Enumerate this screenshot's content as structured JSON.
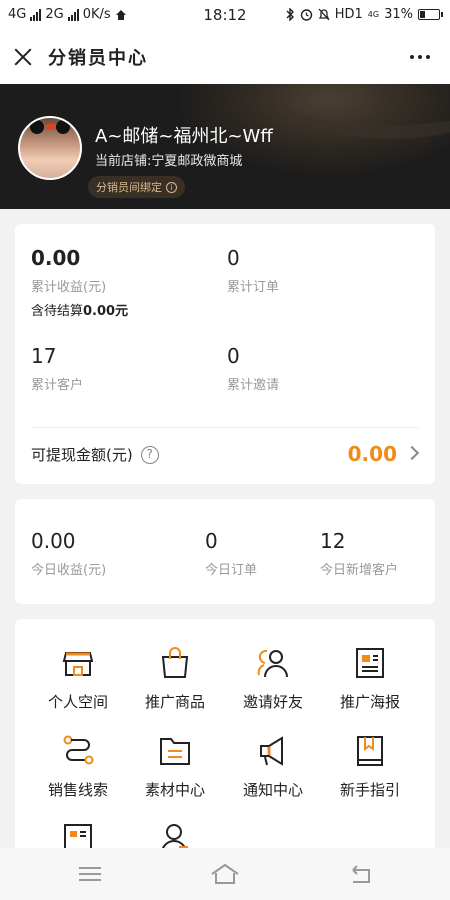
{
  "status_bar": {
    "left": [
      "4G",
      "2G",
      "0K/s"
    ],
    "time": "18:12",
    "right_text": "HD1",
    "network_small": "4G",
    "battery": "31%",
    "battery_level": 0.31
  },
  "header": {
    "title": "分销员中心"
  },
  "profile": {
    "name": "A~邮储~福州北~Wff",
    "shop": "当前店铺:宁夏邮政微商城",
    "bind_label": "分销员间绑定"
  },
  "summary": {
    "total_income": {
      "value": "0.00",
      "label": "累计收益(元)",
      "pending": "含待结算",
      "pending_value": "0.00元"
    },
    "total_orders": {
      "value": "0",
      "label": "累计订单"
    },
    "total_customers": {
      "value": "17",
      "label": "累计客户"
    },
    "total_invites": {
      "value": "0",
      "label": "累计邀请"
    },
    "withdraw": {
      "label": "可提现金额(元)",
      "value": "0.00",
      "help": "?"
    }
  },
  "today": {
    "income": {
      "value": "0.00",
      "label": "今日收益(元)"
    },
    "orders": {
      "value": "0",
      "label": "今日订单"
    },
    "new_customers": {
      "value": "12",
      "label": "今日新增客户"
    }
  },
  "menu": [
    {
      "label": "个人空间",
      "icon": "store-icon"
    },
    {
      "label": "推广商品",
      "icon": "shopping-bag-icon"
    },
    {
      "label": "邀请好友",
      "icon": "invite-friends-icon"
    },
    {
      "label": "推广海报",
      "icon": "poster-icon"
    },
    {
      "label": "销售线索",
      "icon": "sales-leads-icon"
    },
    {
      "label": "素材中心",
      "icon": "folder-icon"
    },
    {
      "label": "通知中心",
      "icon": "megaphone-icon"
    },
    {
      "label": "新手指引",
      "icon": "guide-book-icon"
    },
    {
      "label": "",
      "icon": "card-icon"
    },
    {
      "label": "",
      "icon": "user-icon"
    }
  ],
  "colors": {
    "accent": "#f08a18",
    "dark_banner": "#1c1c1c",
    "bind_text": "#d9b98f"
  },
  "nav": [
    "menu-icon",
    "home-icon",
    "back-icon"
  ]
}
